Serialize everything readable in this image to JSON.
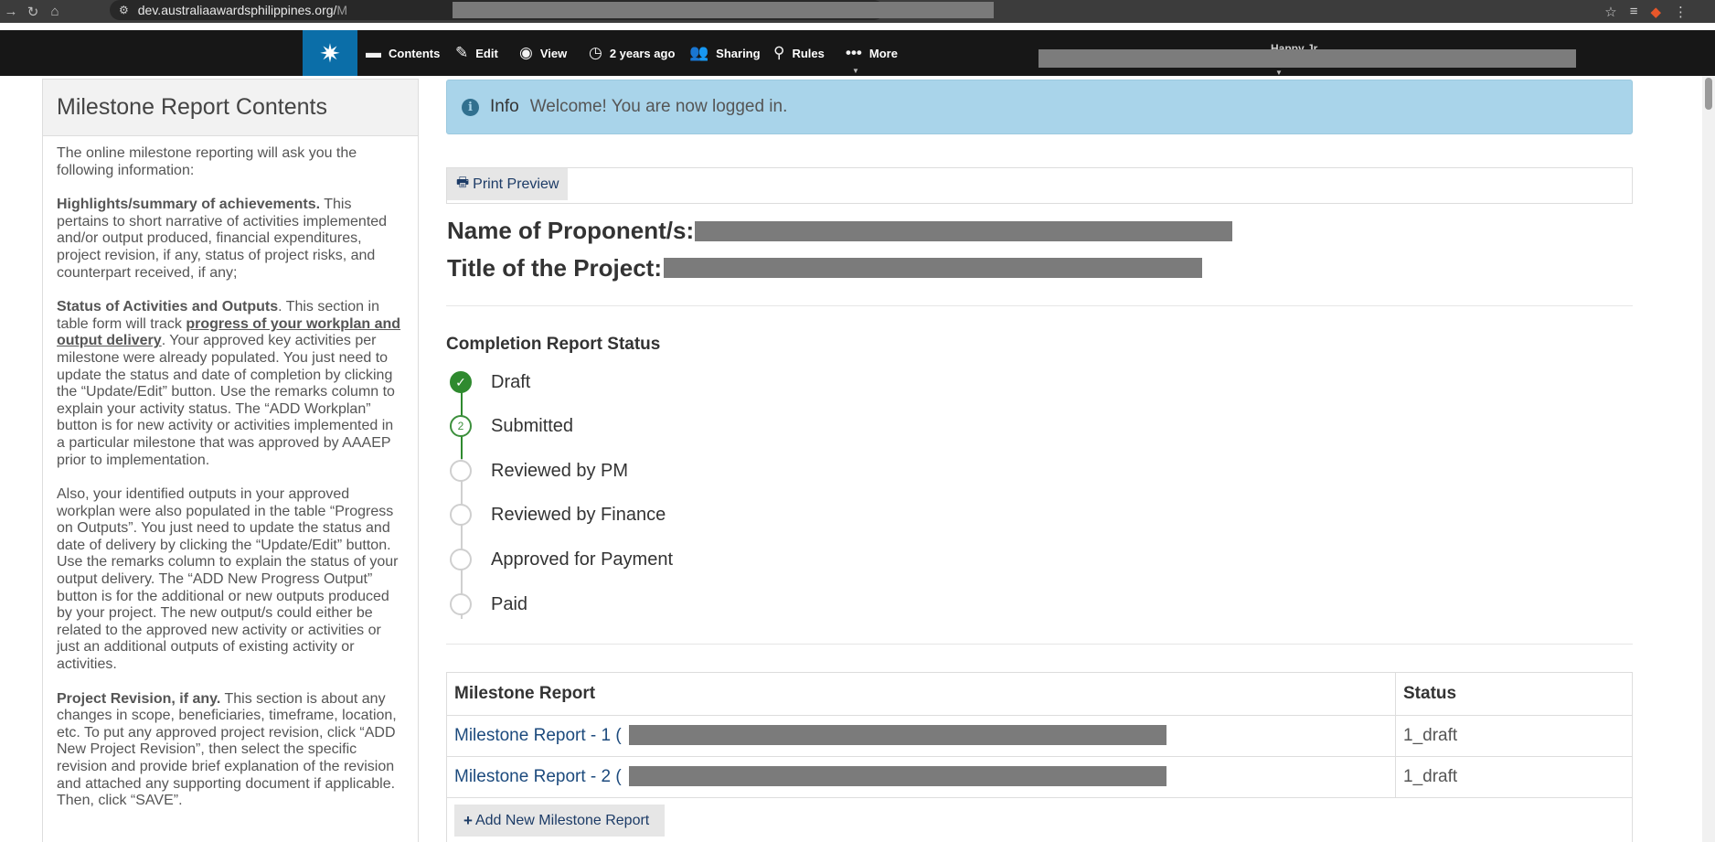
{
  "browser": {
    "url": "dev.australiaawardsphilippines.org/",
    "url_suffix": "M"
  },
  "toolbar": {
    "items": [
      {
        "label": "Contents",
        "icon": "folder-icon"
      },
      {
        "label": "Edit",
        "icon": "pencil-icon"
      },
      {
        "label": "View",
        "icon": "eye-icon"
      },
      {
        "label": "2 years ago",
        "icon": "clock-icon"
      },
      {
        "label": "Sharing",
        "icon": "users-icon"
      },
      {
        "label": "Rules",
        "icon": "sitemap-icon"
      },
      {
        "label": "More",
        "icon": "ellipsis-icon"
      }
    ],
    "user": "Happy Jr."
  },
  "sidebar": {
    "title": "Milestone Report Contents",
    "intro": "The online milestone reporting will ask you the following information:",
    "highlights_heading": "Highlights/summary of achievements.",
    "highlights_text": " This pertains to short narrative of activities implemented and/or output produced, financial expenditures, project revision, if any, status of project risks, and counterpart received, if any;",
    "status_heading": "Status of Activities and Outputs",
    "status_text_1": ". This section in table form will track ",
    "status_link": "progress of your workplan and output delivery",
    "status_text_2": ". Your approved key activities per milestone were already populated. You just need to update the status and date of completion by clicking the “Update/Edit” button. Use the remarks column to explain your activity status. The “ADD Workplan” button is for new activity or activities implemented in a particular milestone that was approved by AAAEP prior to implementation.",
    "outputs_text": "Also, your identified outputs in your approved workplan were also populated in the table “Progress on Outputs”. You just need to update the status and date of delivery by clicking the “Update/Edit” button. Use the remarks column to explain the status of your output delivery. The “ADD New Progress Output” button is for the additional or new outputs produced by your project. The new output/s could either be related to the approved new activity or activities or just an additional outputs of existing activity or activities.",
    "revision_heading": "Project Revision, if any.",
    "revision_text": " This section is about any changes in scope, beneficiaries, timeframe, location, etc. To put any approved project revision, click “ADD New Project Revision”, then select the specific revision and provide brief explanation of the revision and attached any supporting document if applicable. Then, click “SAVE”."
  },
  "alert": {
    "label": "Info",
    "message": "Welcome! You are now logged in."
  },
  "print_preview": "Print Preview",
  "project": {
    "proponent_label": "Name of Proponent/s:",
    "title_label": "Title of the Project:"
  },
  "status": {
    "title": "Completion Report Status",
    "steps": [
      {
        "label": "Draft",
        "state": "done",
        "marker": "✓"
      },
      {
        "label": "Submitted",
        "state": "current",
        "marker": "2"
      },
      {
        "label": "Reviewed by PM",
        "state": "pending",
        "marker": ""
      },
      {
        "label": "Reviewed by Finance",
        "state": "pending",
        "marker": ""
      },
      {
        "label": "Approved for Payment",
        "state": "pending",
        "marker": ""
      },
      {
        "label": "Paid",
        "state": "pending",
        "marker": ""
      }
    ],
    "colors": {
      "done": "#2f8a2f",
      "pending": "#cfcfcf"
    }
  },
  "milestones": {
    "headers": [
      "Milestone Report",
      "Status"
    ],
    "rows": [
      {
        "name": "Milestone Report - 1 (",
        "status": "1_draft"
      },
      {
        "name": "Milestone Report - 2 (",
        "status": "1_draft"
      }
    ],
    "add_label": "Add New Milestone Report"
  }
}
